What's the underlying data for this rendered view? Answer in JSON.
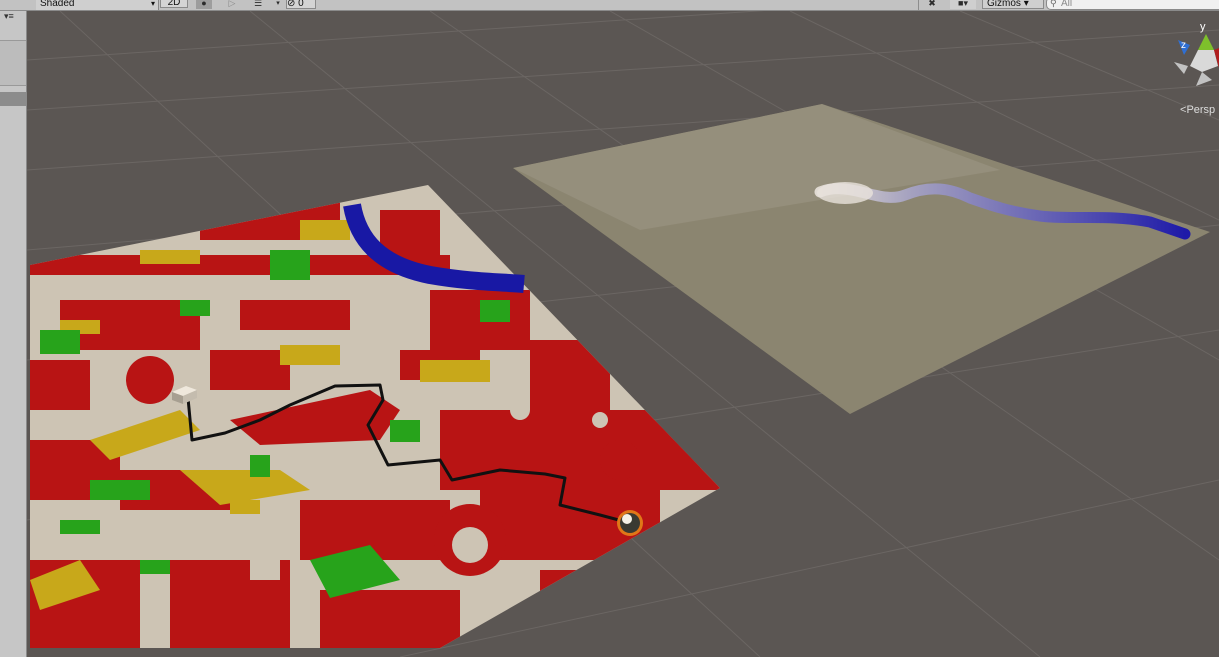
{
  "toolbar": {
    "draw_mode": "Shaded",
    "toggle_2d": "2D",
    "light_icon": "light-bulb-icon",
    "audio_icon": "speaker-icon",
    "effects_icon": "image-layers-icon",
    "hidden_count": "0",
    "gizmos_label": "Gizmos",
    "search_placeholder": "All"
  },
  "scene": {
    "axis_y": "y",
    "axis_z": "z",
    "projection_label": "Persp",
    "colors": {
      "background": "#5b5653",
      "grid": "#6b6663",
      "terrain_base": "#cdc4b4",
      "obstacle": "#b81414",
      "grass": "#27a31b",
      "sand": "#c8a81a",
      "river": "#1818a4",
      "influence_plane": "#8b8570",
      "path": "#111111",
      "agent_ring": "#e07718"
    },
    "objects": [
      "terrain-grid-map",
      "influence-map-plane",
      "river-path",
      "agent-path-line",
      "start-cube",
      "agent-sphere"
    ]
  }
}
